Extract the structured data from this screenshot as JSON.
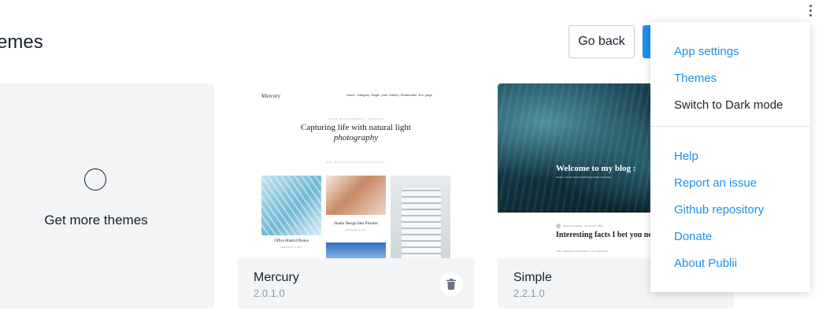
{
  "header": {
    "title": "emes",
    "go_back_label": "Go back"
  },
  "get_more": {
    "label": "Get more themes"
  },
  "themes": [
    {
      "name": "Mercury",
      "version": "2.0.1.0",
      "preview": {
        "logo": "Mercury",
        "nav": "Home  Category  Single post  Gallery  Shortcodes  404 page",
        "kicker": "YOUR PHOTOGRAPHY STORIES",
        "headline_1": "Capturing life with natural light",
        "headline_2": "photography",
        "tags": "ALL  MUSIC  PEOPLE  PHOTO  TIPS",
        "caption_1": "Office Madrid Photos",
        "caption_1_date": "FEBRUARY 3, 2017",
        "caption_2": "Studio Design Idea Pictures",
        "caption_2_date": "FEBRUARY 3, 2017"
      }
    },
    {
      "name": "Simple",
      "version": "2.2.1.0",
      "preview": {
        "title": "Welcome to my blog :",
        "subtitle": "Create a simple and beautiful blog quickly and easily.",
        "meta": "Nguyen Sebastian  ·  January 20, 2019",
        "post_title": "Interesting facts I bet you never knew about travels",
        "excerpt": "Tellus sollicitudin posuere libero, nec vehicula dui..."
      }
    }
  ],
  "menu": {
    "items_top": [
      "App settings",
      "Themes",
      "Switch to Dark mode"
    ],
    "items_bottom": [
      "Help",
      "Report an issue",
      "Github repository",
      "Donate",
      "About Publii"
    ]
  },
  "colors": {
    "accent": "#1e90ef",
    "text": "#17212d",
    "muted": "#8f98a1",
    "card_bg": "#f3f4f5"
  },
  "icons": {
    "menu": "more-vertical-icon",
    "add": "plus-circle-icon",
    "delete": "trash-icon"
  }
}
